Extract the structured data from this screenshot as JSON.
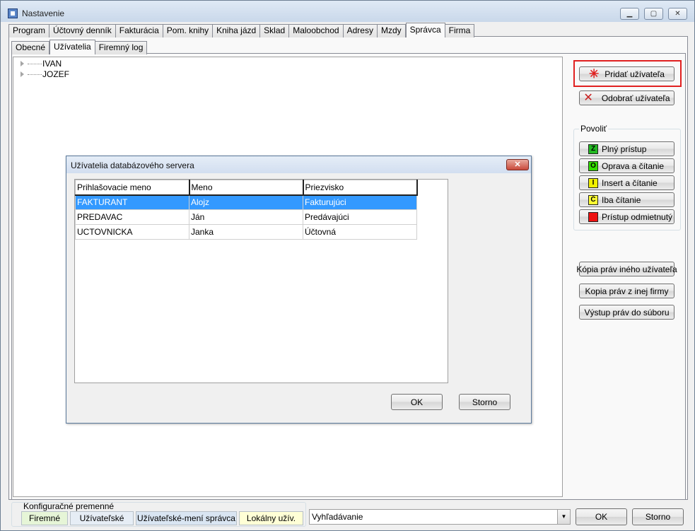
{
  "window": {
    "title": "Nastavenie"
  },
  "main_tabs": [
    {
      "label": "Program"
    },
    {
      "label": "Účtovný denník"
    },
    {
      "label": "Fakturácia"
    },
    {
      "label": "Pom. knihy"
    },
    {
      "label": "Kniha jázd"
    },
    {
      "label": "Sklad"
    },
    {
      "label": "Maloobchod"
    },
    {
      "label": "Adresy"
    },
    {
      "label": "Mzdy"
    },
    {
      "label": "Správca",
      "active": true
    },
    {
      "label": "Firma"
    }
  ],
  "sub_tabs": [
    {
      "label": "Obecné"
    },
    {
      "label": "Užívatelia",
      "active": true
    },
    {
      "label": "Firemný log"
    }
  ],
  "tree": {
    "items": [
      "IVAN",
      "JOZEF"
    ]
  },
  "actions": {
    "add_user": "Pridať užívateľa",
    "remove_user": "Odobrať užívateľa"
  },
  "permissions": {
    "label": "Povoliť",
    "items": [
      {
        "label": "Plný prístup",
        "letter": "Z",
        "color": "#22b922"
      },
      {
        "label": "Oprava a čítanie",
        "letter": "O",
        "color": "#33dd00"
      },
      {
        "label": "Insert a čítanie",
        "letter": "I",
        "color": "#f0f000"
      },
      {
        "label": "Iba čítanie",
        "letter": "Č",
        "color": "#ffff33"
      },
      {
        "label": "Prístup odmietnutý",
        "letter": "",
        "color": "#ee1111"
      }
    ]
  },
  "copy_actions": {
    "copy_from_user": "Kópia práv iného užívateľa",
    "copy_from_firm": "Kopia práv z inej firmy",
    "export_rights": "Výstup práv do súboru"
  },
  "dialog": {
    "title": "Užívatelia databázového servera",
    "columns": [
      "Prihlašovacie meno",
      "Meno",
      "Priezvisko"
    ],
    "rows": [
      [
        "FAKTURANT",
        "Alojz",
        "Fakturujúci"
      ],
      [
        "PREDAVAC",
        "Ján",
        "Predávajúci"
      ],
      [
        "UCTOVNICKA",
        "Janka",
        "Účtovná"
      ]
    ],
    "ok": "OK",
    "cancel": "Storno"
  },
  "config": {
    "label": "Konfiguračné premenné",
    "tabs": [
      {
        "label": "Firemné",
        "color": "#e6f5d7"
      },
      {
        "label": "Užívateľské",
        "color": "#e6edf5"
      },
      {
        "label": "Užívateľské-mení správca",
        "color": "#d9e5f2"
      },
      {
        "label": "Lokálny užív.",
        "color": "#ffffd6"
      }
    ]
  },
  "search": {
    "placeholder": "Vyhľadávanie"
  },
  "footer": {
    "ok": "OK",
    "cancel": "Storno"
  }
}
